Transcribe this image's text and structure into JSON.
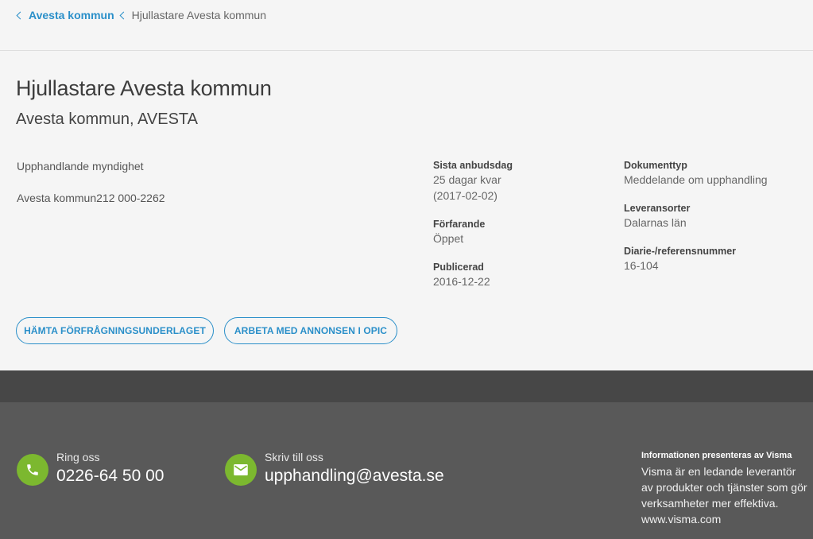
{
  "breadcrumb": {
    "parent": "Avesta kommun",
    "current": "Hjullastare Avesta kommun"
  },
  "header": {
    "title": "Hjullastare Avesta kommun",
    "subtitle": "Avesta kommun, AVESTA"
  },
  "authority": {
    "label": "Upphandlande myndighet",
    "id_line": "Avesta kommun212 000-2262"
  },
  "meta": {
    "deadline_label": "Sista anbudsdag",
    "deadline_remaining": "25 dagar kvar",
    "deadline_date": "(2017-02-02)",
    "procedure_label": "Förfarande",
    "procedure_value": "Öppet",
    "published_label": "Publicerad",
    "published_value": "2016-12-22",
    "doctype_label": "Dokumenttyp",
    "doctype_value": "Meddelande om upphandling",
    "location_label": "Leveransorter",
    "location_value": "Dalarnas län",
    "ref_label": "Diarie-/referensnummer",
    "ref_value": "16-104"
  },
  "actions": {
    "download": "HÄMTA FÖRFRÅGNINGSUNDERLAGET",
    "work_opic": "ARBETA MED ANNONSEN I OPIC"
  },
  "footer": {
    "phone_label": "Ring oss",
    "phone_value": "0226-64 50 00",
    "email_label": "Skriv till oss",
    "email_value": "upphandling@avesta.se",
    "visma_title": "Informationen presenteras av Visma",
    "visma_desc": "Visma är en ledande leverantör av produkter och tjänster som gör verksamheter mer effektiva.",
    "visma_link": "www.visma.com"
  },
  "colors": {
    "accent": "#2a8fc9",
    "icon_green": "#7cb82f",
    "footer_bg": "#595959",
    "footer_band": "#474747"
  },
  "icons": {
    "phone": "phone-icon",
    "email": "envelope-icon",
    "breadcrumb": "chevron-left-icon"
  }
}
